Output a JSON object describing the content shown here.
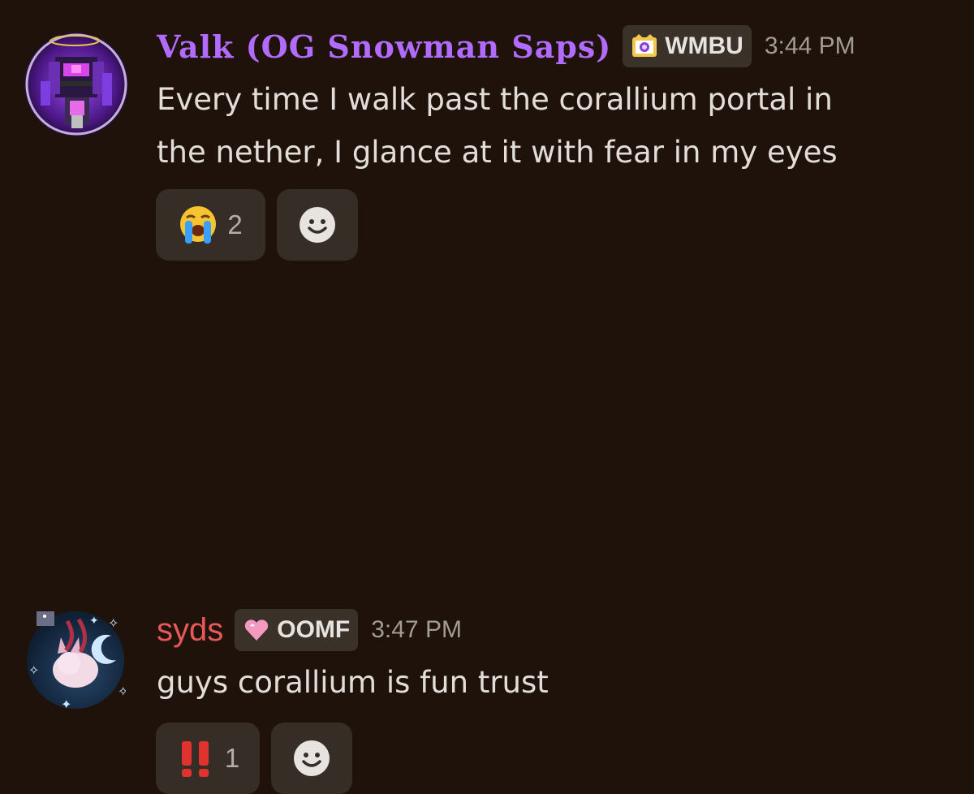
{
  "messages": [
    {
      "username": "Valk (OG Snowman Saps)",
      "username_color": "#b26bff",
      "tag": {
        "label": "WMBU",
        "icon": "crown-tag-icon"
      },
      "timestamp": "3:44 PM",
      "content": "Every time I walk past the corallium portal in\nthe nether, I glance at it with fear in my eyes",
      "reactions": [
        {
          "emoji": "loudly-crying-face",
          "count": "2"
        }
      ]
    },
    {
      "username": "syds",
      "username_color": "#e8585a",
      "tag": {
        "label": "OOMF",
        "icon": "pink-heart-tag-icon"
      },
      "timestamp": "3:47 PM",
      "content": "guys corallium is fun trust",
      "reactions": [
        {
          "emoji": "double-exclamation",
          "count": "1"
        }
      ]
    }
  ],
  "add_reaction_icon": "smiley-face-icon"
}
